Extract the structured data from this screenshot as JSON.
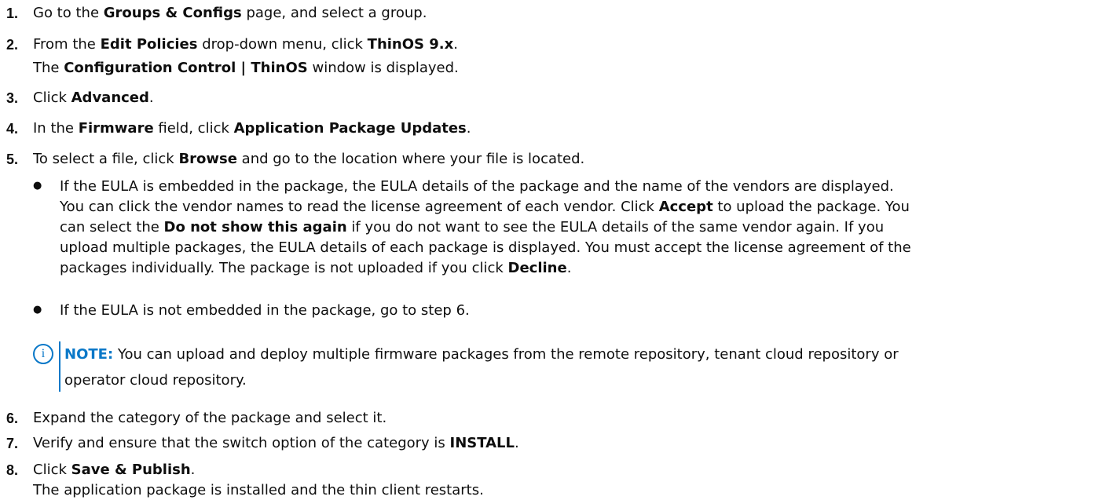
{
  "steps": [
    {
      "num": "1",
      "pre": "Go to the ",
      "b1": "Groups & Configs",
      "post": " page, and select a group."
    },
    {
      "num": "2",
      "pre": "From the ",
      "b1": "Edit Policies",
      "mid": " drop-down menu, click ",
      "b2": "ThinOS 9.x",
      "post": ".",
      "sub_pre": "The ",
      "sub_b": "Configuration Control | ThinOS",
      "sub_post": " window is displayed."
    },
    {
      "num": "3",
      "pre": "Click ",
      "b1": "Advanced",
      "post": "."
    },
    {
      "num": "4",
      "pre": "In the ",
      "b1": "Firmware",
      "mid": " field, click ",
      "b2": "Application Package Updates",
      "post": "."
    },
    {
      "num": "5",
      "pre": "To select a file, click ",
      "b1": "Browse",
      "post": " and go to the location where your file is located."
    },
    {
      "num": "6",
      "pre": "Expand the category of the package and select it."
    },
    {
      "num": "7",
      "pre": "Verify and ensure that the switch option of the category is ",
      "b1": "INSTALL",
      "post": "."
    },
    {
      "num": "8",
      "pre": "Click ",
      "b1": "Save & Publish",
      "post": ".",
      "sub_pre": "The application package is installed and the thin client restarts."
    }
  ],
  "bullets": {
    "b1": {
      "l1": "If the EULA is embedded in the package, the EULA details of the package and the name of the vendors are displayed.",
      "l2_pre": "You can click the vendor names to read the license agreement of each vendor. Click ",
      "l2_b": "Accept",
      "l2_post": " to upload the package. You",
      "l3_pre": "can select the ",
      "l3_b": "Do not show this again",
      "l3_post": " if you do not want to see the EULA details of the same vendor again. If you",
      "l4": "upload multiple packages, the EULA details of each package is displayed. You must accept the license agreement of the",
      "l5_pre": "packages individually. The package is not uploaded if you click ",
      "l5_b": "Decline",
      "l5_post": "."
    },
    "b2": {
      "text": "If the EULA is not embedded in the package, go to step 6."
    }
  },
  "note": {
    "label": "NOTE:",
    "line1": " You can upload and deploy multiple firmware packages from the remote repository, tenant cloud repository or",
    "line2": "operator cloud repository.",
    "icon": "info-icon",
    "accent": "#0a78c8"
  }
}
